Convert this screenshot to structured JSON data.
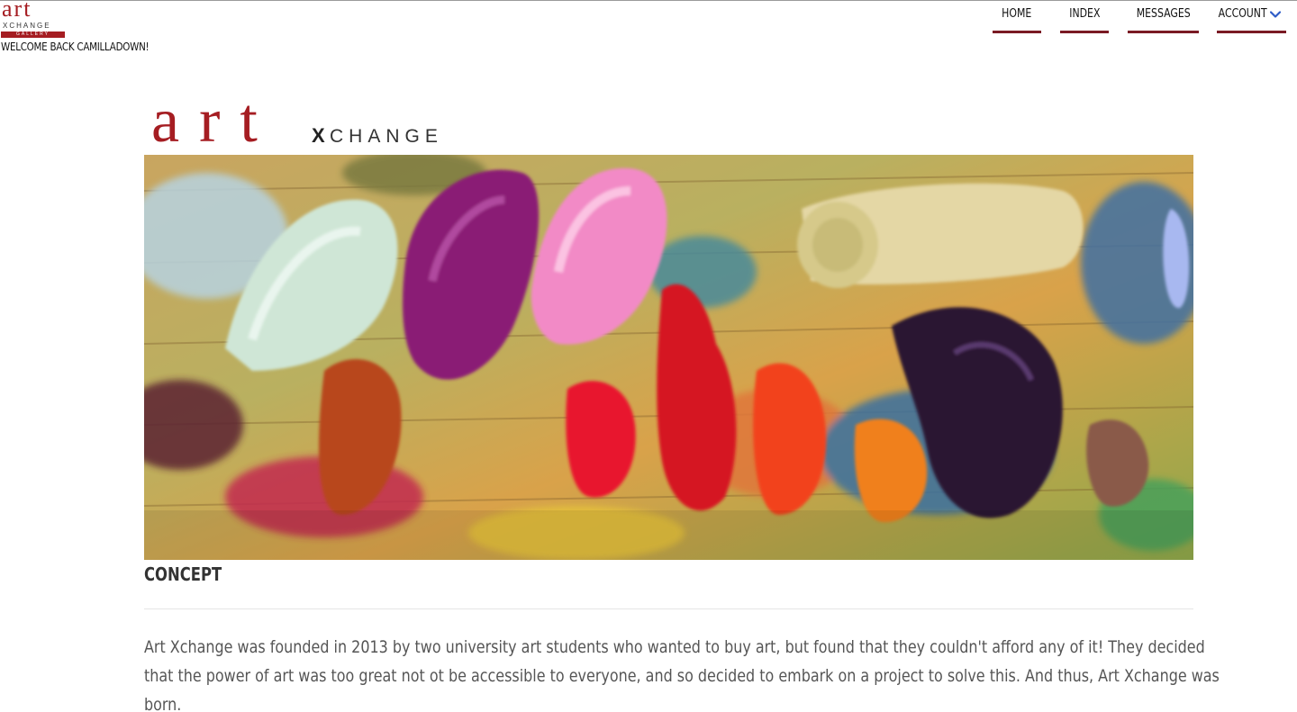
{
  "header": {
    "mini_logo": {
      "art": "art",
      "xchange": "XCHANGE",
      "gallery": "GALLERY"
    },
    "welcome": "WELCOME BACK CAMILLADOWN!"
  },
  "nav": {
    "items": [
      {
        "label": "HOME"
      },
      {
        "label": "INDEX"
      },
      {
        "label": "MESSAGES"
      },
      {
        "label": "ACCOUNT",
        "icon": "chevron-down-icon"
      }
    ]
  },
  "hero": {
    "logo_art": "art",
    "logo_x": "X",
    "logo_change": "CHANGE",
    "image_alt": "paint-palette-image"
  },
  "concept": {
    "heading": "CONCEPT",
    "lines": [
      "Art Xchange was founded in 2013 by two university art students who wanted to buy art, but found that they couldn't afford any of it! They decided",
      "that the power of art was too great not ot be accessible to everyone, and so decided to embark on a project to solve this. And thus, Art Xchange was",
      "born."
    ]
  },
  "colors": {
    "brand_red": "#a51d22",
    "nav_underline": "#7a1a24",
    "chevron": "#2e5cc7"
  }
}
